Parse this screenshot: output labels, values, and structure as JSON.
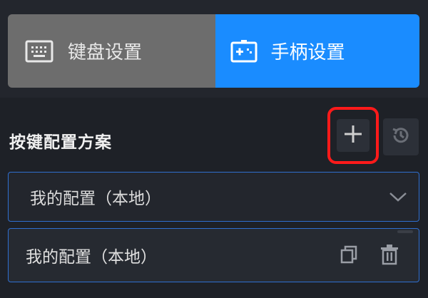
{
  "tabs": {
    "keyboard_label": "键盘设置",
    "gamepad_label": "手柄设置",
    "active": "gamepad"
  },
  "section": {
    "title": "按键配置方案"
  },
  "select": {
    "value": "我的配置（本地）"
  },
  "list": {
    "items": [
      {
        "label": "我的配置（本地）"
      }
    ]
  },
  "colors": {
    "accent": "#1a8cff",
    "inactive_tab": "#6d6d6d",
    "highlight_border": "#ff1a1a",
    "background": "#1e2127"
  },
  "icons": {
    "keyboard": "keyboard-icon",
    "gamepad": "gamepad-icon",
    "add": "plus-icon",
    "history": "history-icon",
    "dropdown": "chevron-down-icon",
    "copy": "copy-icon",
    "delete": "trash-icon"
  }
}
